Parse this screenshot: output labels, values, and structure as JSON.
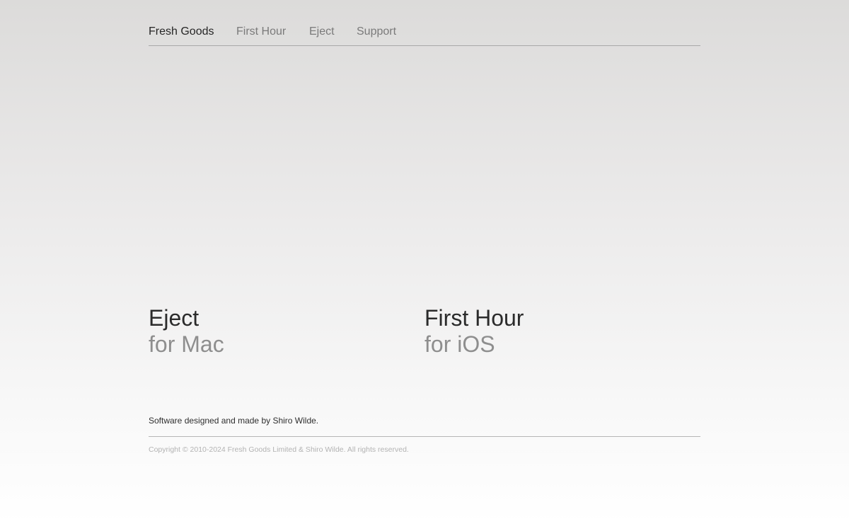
{
  "nav": {
    "brand": "Fresh Goods",
    "items": [
      {
        "label": "First Hour"
      },
      {
        "label": "Eject"
      },
      {
        "label": "Support"
      }
    ]
  },
  "products": [
    {
      "name": "Eject",
      "platform": "for Mac"
    },
    {
      "name": "First Hour",
      "platform": "for iOS"
    }
  ],
  "footer": {
    "credit": "Software designed and made by Shiro Wilde.",
    "copyright": "Copyright © 2010-2024 Fresh Goods Limited & Shiro Wilde. All rights reserved."
  }
}
